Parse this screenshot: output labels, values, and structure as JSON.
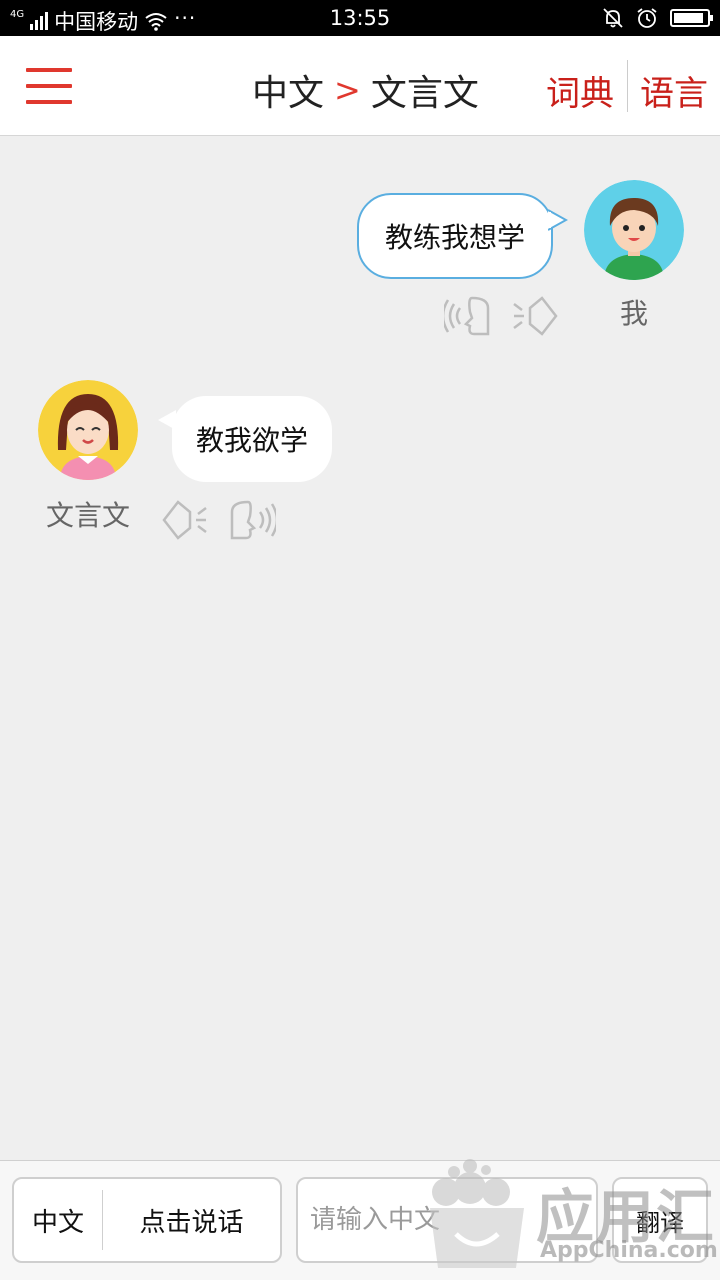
{
  "status_bar": {
    "network": "4G",
    "carrier": "中国移动",
    "more": "···",
    "time": "13:55",
    "battery_level": 0.92
  },
  "header": {
    "source_lang": "中文",
    "arrow": ">",
    "target_lang": "文言文",
    "dict_label": "词典",
    "lang_label": "语言"
  },
  "chat": {
    "me": {
      "name": "我",
      "text": "教练我想学"
    },
    "bot": {
      "name": "文言文",
      "text": "教我欲学"
    }
  },
  "bottom": {
    "source_lang": "中文",
    "speak_label": "点击说话",
    "input_placeholder": "请输入中文",
    "translate_label": "翻译"
  },
  "watermark": {
    "name": "应用汇",
    "url": "AppChina.com"
  },
  "colors": {
    "accent_red": "#e0382e",
    "bubble_border_blue": "#5aaee0",
    "background": "#efefef"
  },
  "icons": {
    "menu": "hamburger-menu-icon",
    "mic": "mic-wave-icon",
    "speaker": "speaker-icon"
  }
}
